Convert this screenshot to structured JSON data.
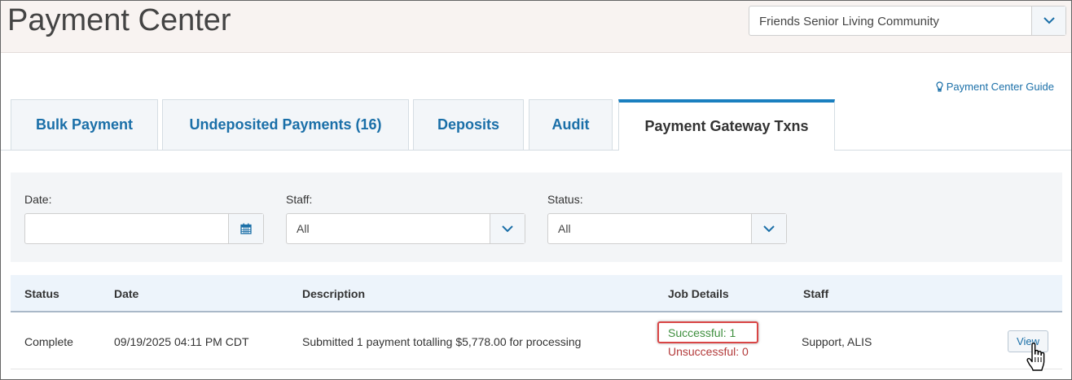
{
  "header": {
    "title": "Payment Center",
    "community_select": {
      "value": "Friends Senior Living Community",
      "icon": "chevron-down-icon"
    }
  },
  "guide_link": {
    "label": "Payment Center Guide",
    "icon": "lightbulb-icon"
  },
  "tabs": [
    {
      "label": "Bulk Payment",
      "active": false
    },
    {
      "label": "Undeposited Payments (16)",
      "active": false
    },
    {
      "label": "Deposits",
      "active": false
    },
    {
      "label": "Audit",
      "active": false
    },
    {
      "label": "Payment Gateway Txns",
      "active": true
    }
  ],
  "filters": {
    "date": {
      "label": "Date:",
      "value": "",
      "icon": "calendar-icon"
    },
    "staff": {
      "label": "Staff:",
      "value": "All",
      "icon": "chevron-down-icon"
    },
    "status": {
      "label": "Status:",
      "value": "All",
      "icon": "chevron-down-icon"
    }
  },
  "table": {
    "columns": [
      "Status",
      "Date",
      "Description",
      "Job Details",
      "Staff"
    ],
    "rows": [
      {
        "status": "Complete",
        "date": "09/19/2025 04:11 PM CDT",
        "description": "Submitted 1 payment totalling $5,778.00 for processing",
        "job_success": "Successful: 1",
        "job_failure": "Unsuccessful: 0",
        "staff": "Support, ALIS",
        "action_label": "View"
      }
    ]
  },
  "colors": {
    "accent": "#1a6fa8",
    "active_tab_border": "#1a7fbf",
    "success": "#3e8f3e",
    "failure": "#b33a3a",
    "highlight": "#d94545"
  }
}
